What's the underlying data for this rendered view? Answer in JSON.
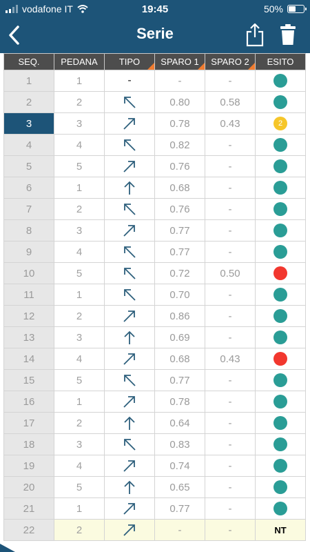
{
  "status_bar": {
    "carrier": "vodafone IT",
    "time": "19:45",
    "battery": "50%",
    "battery_level": 0.5
  },
  "nav": {
    "title": "Serie",
    "back_icon": "chevron-left-icon",
    "share_icon": "share-icon",
    "trash_icon": "trash-icon"
  },
  "colors": {
    "header_bg": "#1d5478",
    "esito_ok": "#2a9d96",
    "esito_miss": "#f2372e",
    "esito_second": "#f6c629",
    "column_header_bg": "#4d4d4d",
    "sort_marker": "#f07c30"
  },
  "columns": [
    "SEQ.",
    "PEDANA",
    "TIPO",
    "SPARO 1",
    "SPARO 2",
    "ESITO"
  ],
  "rows": [
    {
      "seq": "1",
      "pedana": "1",
      "tipo": "none",
      "sparo1": "-",
      "sparo2": "-",
      "esito": "teal"
    },
    {
      "seq": "2",
      "pedana": "2",
      "tipo": "up-left",
      "sparo1": "0.80",
      "sparo2": "0.58",
      "esito": "teal"
    },
    {
      "seq": "3",
      "pedana": "3",
      "tipo": "up-right",
      "sparo1": "0.78",
      "sparo2": "0.43",
      "esito": "yellow",
      "esito_label": "2",
      "selected": true
    },
    {
      "seq": "4",
      "pedana": "4",
      "tipo": "up-left",
      "sparo1": "0.82",
      "sparo2": "-",
      "esito": "teal"
    },
    {
      "seq": "5",
      "pedana": "5",
      "tipo": "up-right",
      "sparo1": "0.76",
      "sparo2": "-",
      "esito": "teal"
    },
    {
      "seq": "6",
      "pedana": "1",
      "tipo": "up",
      "sparo1": "0.68",
      "sparo2": "-",
      "esito": "teal"
    },
    {
      "seq": "7",
      "pedana": "2",
      "tipo": "up-left",
      "sparo1": "0.76",
      "sparo2": "-",
      "esito": "teal"
    },
    {
      "seq": "8",
      "pedana": "3",
      "tipo": "up-right",
      "sparo1": "0.77",
      "sparo2": "-",
      "esito": "teal"
    },
    {
      "seq": "9",
      "pedana": "4",
      "tipo": "up-left",
      "sparo1": "0.77",
      "sparo2": "-",
      "esito": "teal"
    },
    {
      "seq": "10",
      "pedana": "5",
      "tipo": "up-left",
      "sparo1": "0.72",
      "sparo2": "0.50",
      "esito": "red"
    },
    {
      "seq": "11",
      "pedana": "1",
      "tipo": "up-left",
      "sparo1": "0.70",
      "sparo2": "-",
      "esito": "teal"
    },
    {
      "seq": "12",
      "pedana": "2",
      "tipo": "up-right",
      "sparo1": "0.86",
      "sparo2": "-",
      "esito": "teal"
    },
    {
      "seq": "13",
      "pedana": "3",
      "tipo": "up",
      "sparo1": "0.69",
      "sparo2": "-",
      "esito": "teal"
    },
    {
      "seq": "14",
      "pedana": "4",
      "tipo": "up-right",
      "sparo1": "0.68",
      "sparo2": "0.43",
      "esito": "red"
    },
    {
      "seq": "15",
      "pedana": "5",
      "tipo": "up-left",
      "sparo1": "0.77",
      "sparo2": "-",
      "esito": "teal"
    },
    {
      "seq": "16",
      "pedana": "1",
      "tipo": "up-right",
      "sparo1": "0.78",
      "sparo2": "-",
      "esito": "teal"
    },
    {
      "seq": "17",
      "pedana": "2",
      "tipo": "up",
      "sparo1": "0.64",
      "sparo2": "-",
      "esito": "teal"
    },
    {
      "seq": "18",
      "pedana": "3",
      "tipo": "up-left",
      "sparo1": "0.83",
      "sparo2": "-",
      "esito": "teal"
    },
    {
      "seq": "19",
      "pedana": "4",
      "tipo": "up-right",
      "sparo1": "0.74",
      "sparo2": "-",
      "esito": "teal"
    },
    {
      "seq": "20",
      "pedana": "5",
      "tipo": "up",
      "sparo1": "0.65",
      "sparo2": "-",
      "esito": "teal"
    },
    {
      "seq": "21",
      "pedana": "1",
      "tipo": "up-right",
      "sparo1": "0.77",
      "sparo2": "-",
      "esito": "teal"
    },
    {
      "seq": "22",
      "pedana": "2",
      "tipo": "up-right",
      "sparo1": "-",
      "sparo2": "-",
      "esito": "nt",
      "esito_label": "NT",
      "highlight": true
    }
  ]
}
